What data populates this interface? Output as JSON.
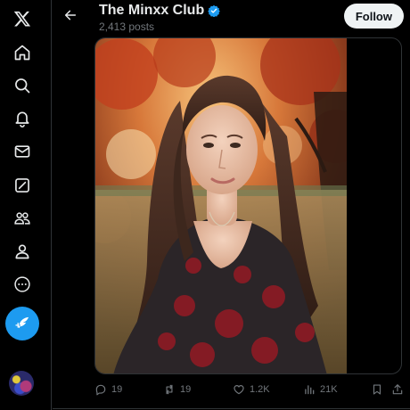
{
  "nav": {
    "items": [
      {
        "name": "x-logo-icon"
      },
      {
        "name": "home-icon"
      },
      {
        "name": "explore-icon"
      },
      {
        "name": "notifications-icon"
      },
      {
        "name": "messages-icon"
      },
      {
        "name": "grok-icon"
      },
      {
        "name": "communities-icon"
      },
      {
        "name": "profile-icon"
      },
      {
        "name": "more-icon"
      }
    ],
    "post_button_icon": "compose-feather-icon"
  },
  "header": {
    "title": "The Minxx Club",
    "verified": true,
    "posts_count": "2,413 posts",
    "follow_label": "Follow"
  },
  "actions": {
    "replies": "19",
    "reposts": "19",
    "likes": "1.2K",
    "views": "21K"
  },
  "colors": {
    "accent": "#1d9bf0",
    "background": "#000000",
    "muted_text": "#71767b",
    "follow_bg": "#eff3f4"
  }
}
